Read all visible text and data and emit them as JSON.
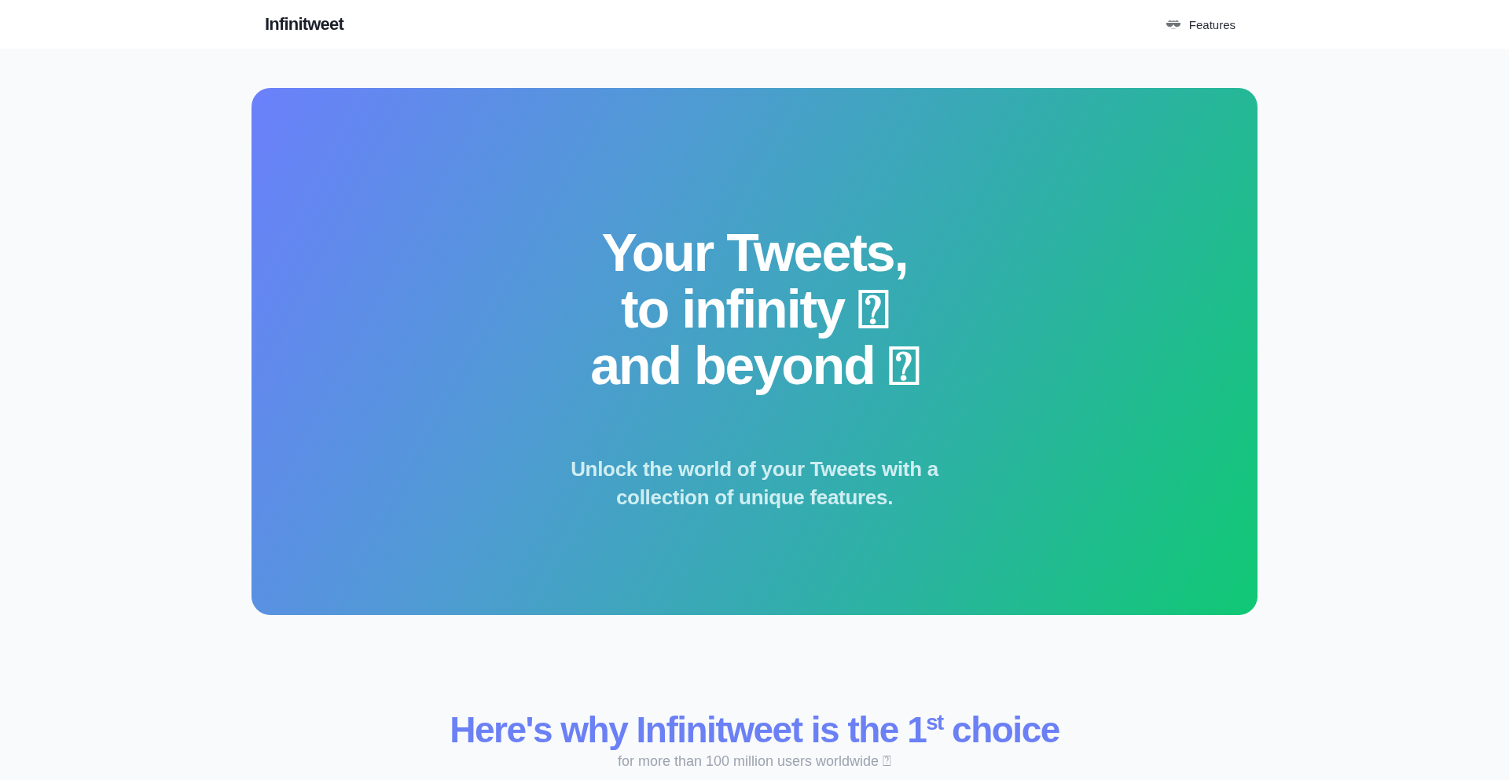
{
  "header": {
    "logo": "Infinitweet",
    "nav": [
      {
        "label": "Features"
      }
    ]
  },
  "hero": {
    "headline_lines": [
      "Your Tweets,",
      "to infinity ⍰",
      "and beyond ⍰"
    ],
    "subtitle": "Unlock the world of your Tweets with a collection of unique features."
  },
  "why": {
    "heading": "Here's why Infinitweet is the 1$^{st}$ choice",
    "subheading": "for more than 100 million users worldwide ⍰"
  }
}
